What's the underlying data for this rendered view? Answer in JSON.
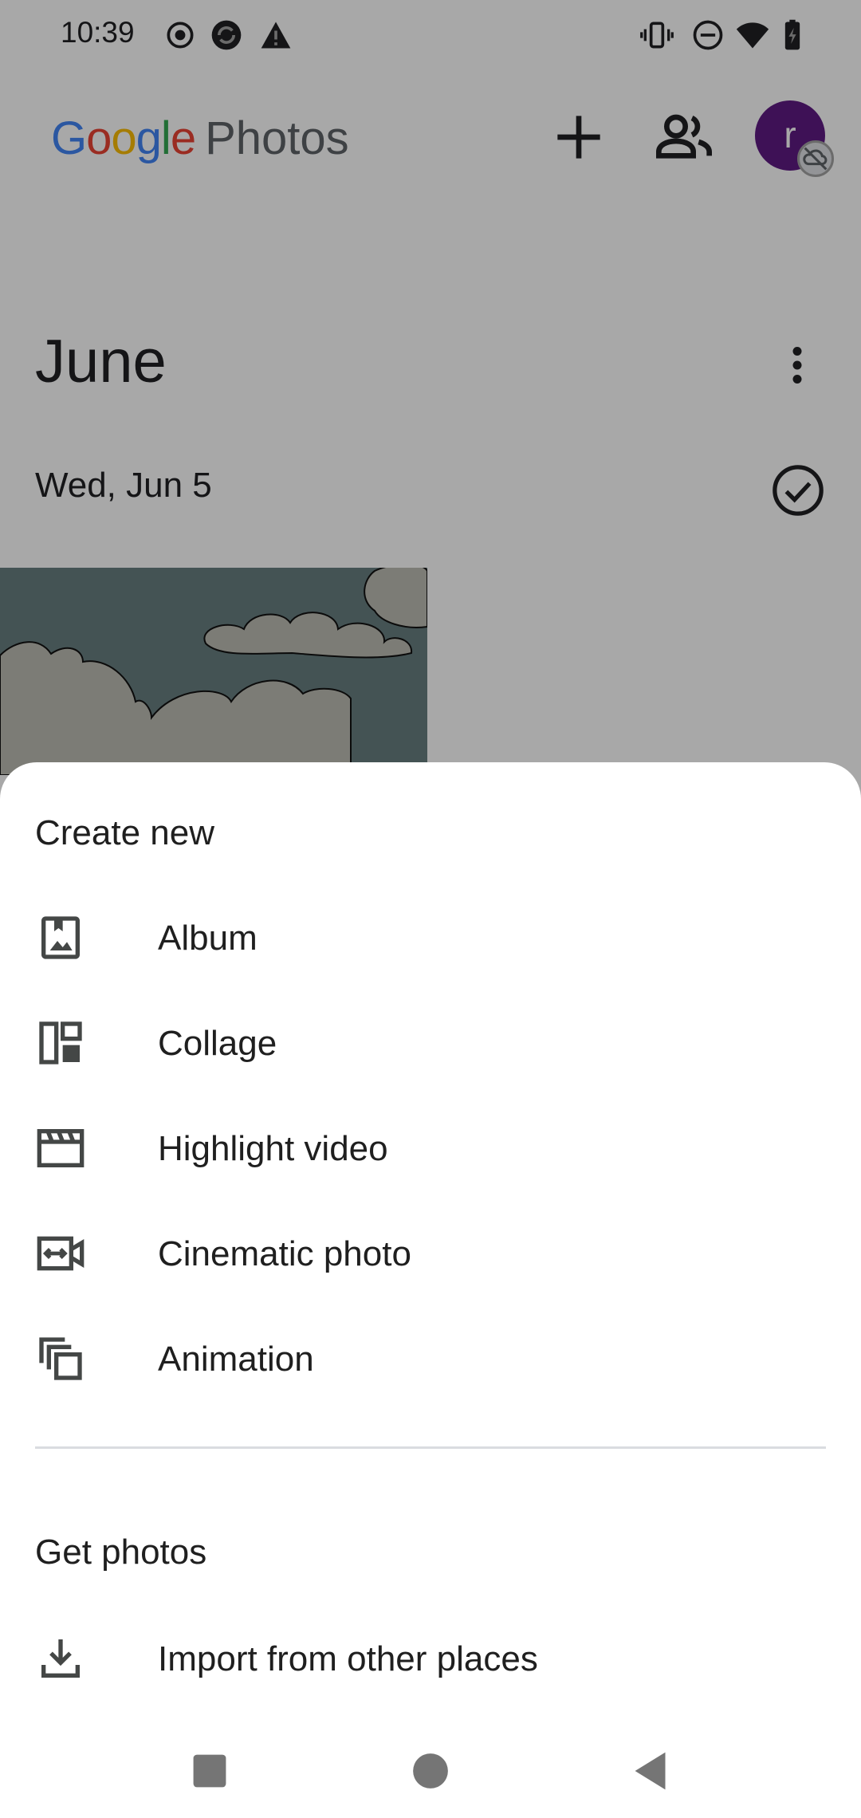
{
  "status_bar": {
    "time": "10:39",
    "icons": [
      "record-icon",
      "sync-icon",
      "warning-icon",
      "vibrate-icon",
      "do-not-disturb-icon",
      "wifi-icon",
      "battery-charging-icon"
    ]
  },
  "app_bar": {
    "logo_google": [
      "G",
      "o",
      "o",
      "g",
      "l",
      "e"
    ],
    "logo_photos": "Photos",
    "avatar_initial": "r",
    "icons": [
      "add-icon",
      "sharing-icon",
      "backup-off-icon"
    ]
  },
  "timeline": {
    "month": "June",
    "date": "Wed, Jun 5",
    "icons": [
      "more-vert-icon",
      "check-circle-icon"
    ]
  },
  "sheet": {
    "create_title": "Create new",
    "create_items": [
      {
        "label": "Album",
        "icon": "album-icon"
      },
      {
        "label": "Collage",
        "icon": "collage-icon"
      },
      {
        "label": "Highlight video",
        "icon": "highlight-video-icon"
      },
      {
        "label": "Cinematic photo",
        "icon": "cinematic-photo-icon"
      },
      {
        "label": "Animation",
        "icon": "animation-icon"
      }
    ],
    "get_title": "Get photos",
    "get_items": [
      {
        "label": "Import from other places",
        "icon": "download-icon"
      }
    ]
  },
  "nav_bar": {
    "icons": [
      "recents-icon",
      "home-icon",
      "back-icon"
    ]
  },
  "colors": {
    "avatar": "#5e1a83",
    "scrim": "#000000",
    "sheet": "#ffffff",
    "text": "#1f1f1f"
  }
}
